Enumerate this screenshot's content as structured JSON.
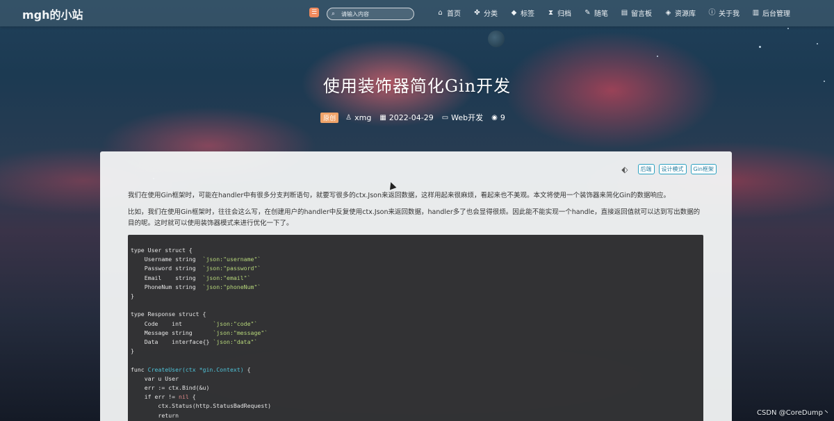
{
  "nav": {
    "brand": "mgh的小站",
    "search_placeholder": "请输入内容",
    "items": [
      {
        "label": "首页",
        "icon": "home-icon",
        "glyph": "⌂"
      },
      {
        "label": "分类",
        "icon": "grid-icon",
        "glyph": "✤"
      },
      {
        "label": "标签",
        "icon": "tag-icon",
        "glyph": "◆"
      },
      {
        "label": "归档",
        "icon": "hourglass-icon",
        "glyph": "⧗"
      },
      {
        "label": "随笔",
        "icon": "pen-icon",
        "glyph": "✎"
      },
      {
        "label": "留言板",
        "icon": "book-icon",
        "glyph": "▤"
      },
      {
        "label": "资源库",
        "icon": "stack-icon",
        "glyph": "◈"
      },
      {
        "label": "关于我",
        "icon": "info-icon",
        "glyph": "ⓘ"
      },
      {
        "label": "后台管理",
        "icon": "clipboard-icon",
        "glyph": "▥"
      }
    ]
  },
  "post": {
    "title": "使用装饰器简化Gin开发",
    "badge": "原创",
    "author": "xmg",
    "date": "2022-04-29",
    "category": "Web开发",
    "views": "9",
    "tags": [
      "后端",
      "设计模式",
      "Gin框架"
    ],
    "paragraphs": [
      "我们在使用Gin框架时，可能在handler中有很多分支判断语句，就要写很多的ctx.Json来返回数据，这样用起来很麻烦，看起来也不美观。本文将使用一个装饰器来简化Gin的数据响应。",
      "比如，我们在使用Gin框架时，往往会这么写，在创建用户的handler中反复使用ctx.Json来返回数据，handler多了也会显得很烦。因此能不能实现一个handle，直接返回值就可以达到写出数据的目的呢。这时就可以使用装饰器模式来进行优化一下了。"
    ],
    "code_lines": [
      "type User struct {",
      "    Username string  `json:\"username\"`",
      "    Password string  `json:\"password\"`",
      "    Email    string  `json:\"email\"`",
      "    PhoneNum string  `json:\"phoneNum\"`",
      "}",
      "",
      "type Response struct {",
      "    Code    int         `json:\"code\"`",
      "    Message string      `json:\"message\"`",
      "    Data    interface{} `json:\"data\"`",
      "}",
      "",
      "func CreateUser(ctx *gin.Context) {",
      "    var u User",
      "    err := ctx.Bind(&u)",
      "    if err != nil {",
      "        ctx.Status(http.StatusBadRequest)",
      "        return"
    ]
  },
  "watermark": "CSDN @CoreDump丶",
  "colors": {
    "accent": "#2aa0c0",
    "badge": "#f0a46a",
    "code_bg": "#222224",
    "code_string": "#b6d67a",
    "code_func": "#4fc3d8"
  }
}
